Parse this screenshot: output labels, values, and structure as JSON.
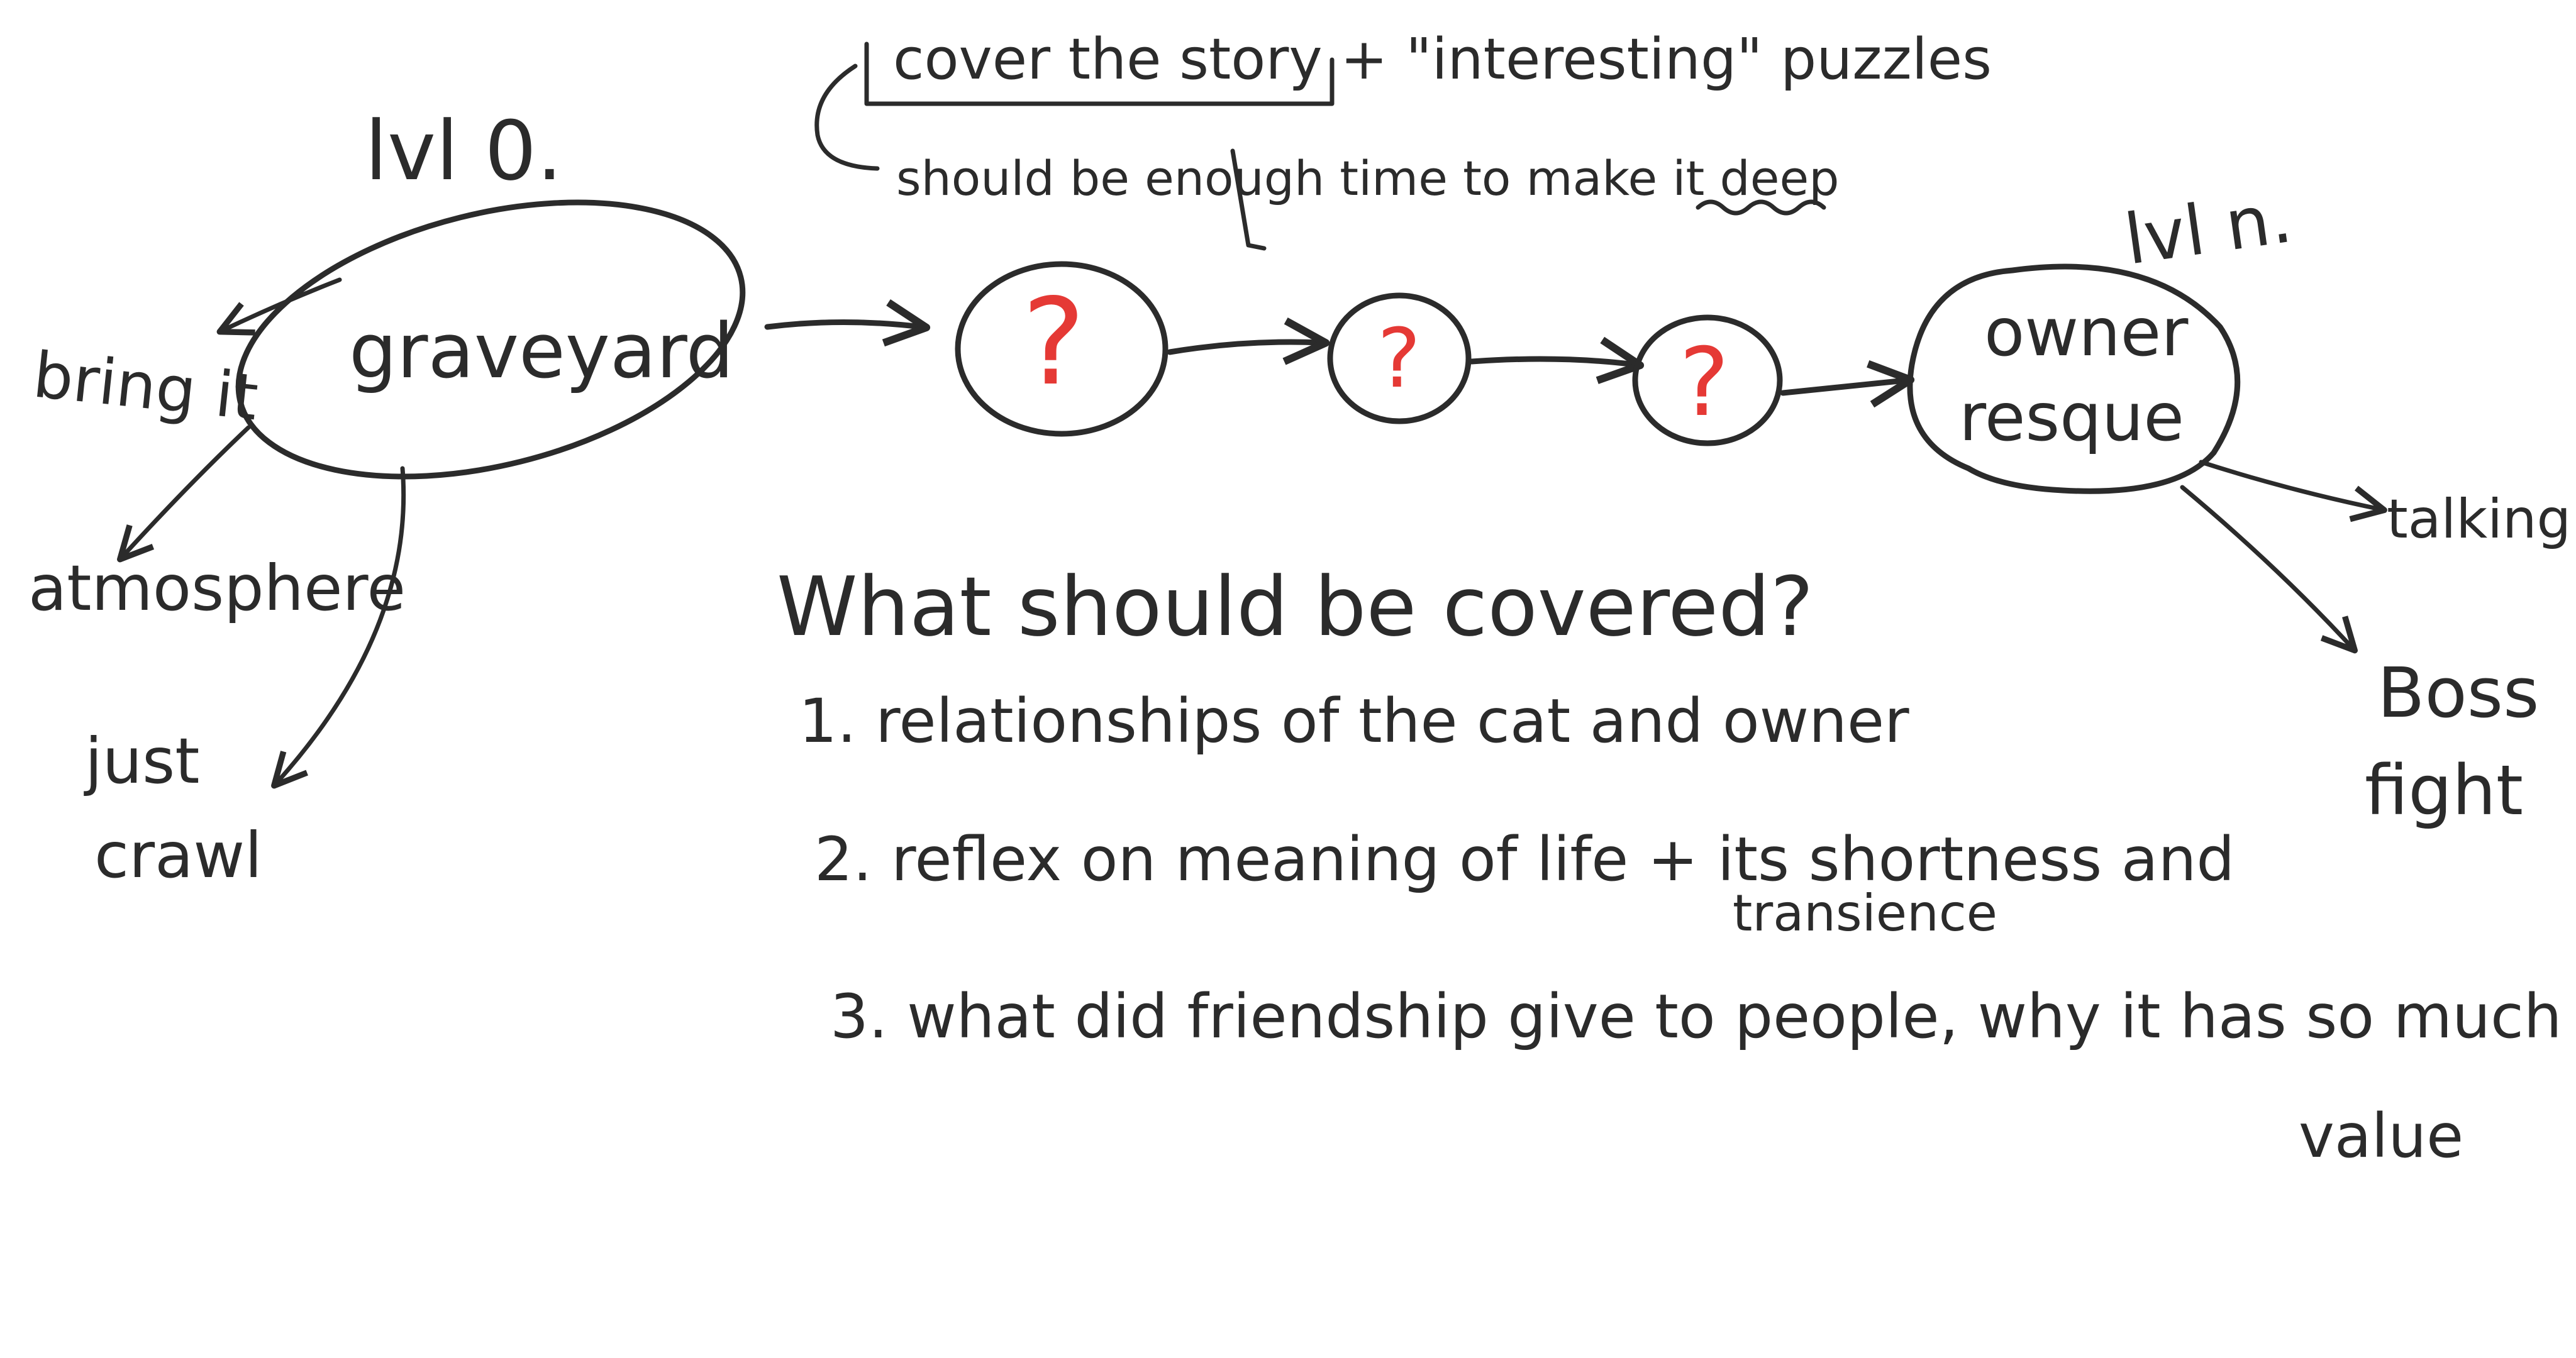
{
  "colors": {
    "ink": "#2b2b2b",
    "question": "#e53935",
    "background": "#ffffff"
  },
  "notes": {
    "top_line_1": "cover the story + \"interesting\" puzzles",
    "top_line_2": "should be enough time to make it deep",
    "level_start": "lvl 0.",
    "level_end": "lvl n."
  },
  "nodes": {
    "graveyard": "graveyard",
    "unknown_1": "?",
    "unknown_2": "?",
    "unknown_3": "?",
    "owner_rescue_line_1": "owner",
    "owner_rescue_line_2": "resque"
  },
  "branches": {
    "bring_it": "bring it",
    "atmosphere": "atmosphere",
    "just_crawl_line_1": "just",
    "just_crawl_line_2": "crawl",
    "talking": "talking",
    "boss_fight_line_1": "Boss",
    "boss_fight_line_2": "fight"
  },
  "coverage": {
    "heading": "What should be covered?",
    "items": [
      "1. relationships of the cat and owner",
      "2. reflex on meaning of life + its shortness and",
      "transience",
      "3. what did friendship give to people, why it has so much",
      "value"
    ]
  }
}
